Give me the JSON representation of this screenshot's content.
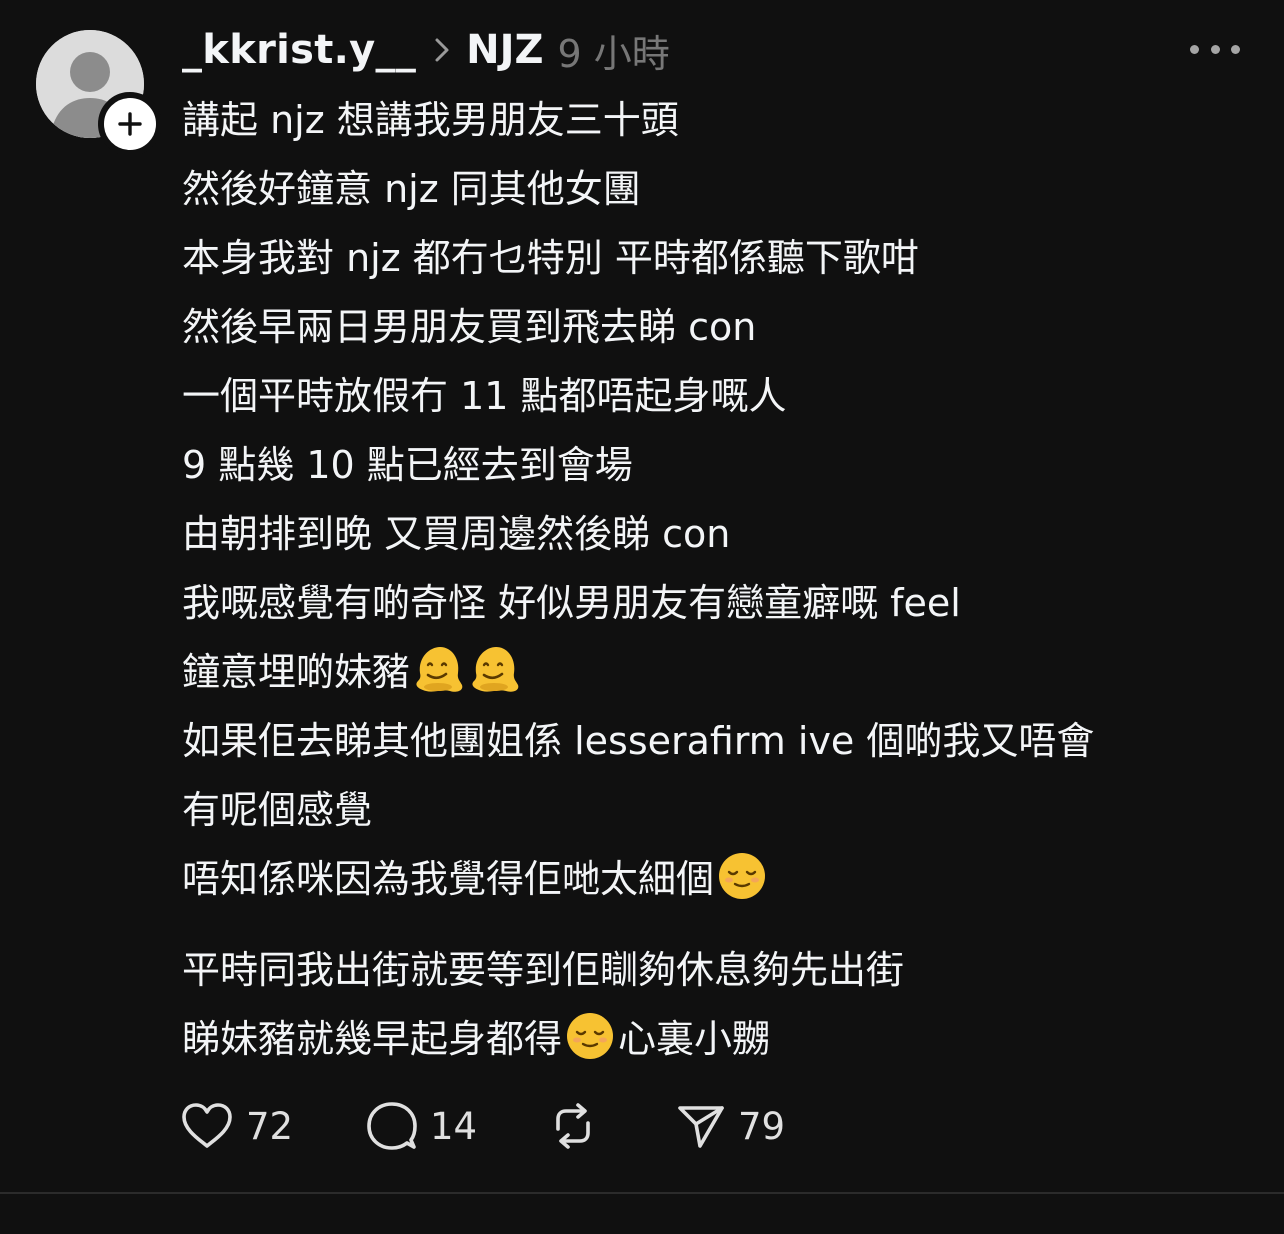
{
  "post": {
    "username": "_kkrist.y__",
    "community": "NJZ",
    "time": "9 小時",
    "body_lines": [
      "講起 njz 想講我男朋友三十頭",
      "然後好鐘意 njz 同其他女團",
      "本身我對 njz 都冇乜特別 平時都係聽下歌咁",
      "然後早兩日男朋友買到飛去睇 con",
      "一個平時放假冇 11 點都唔起身嘅人",
      "9 點幾 10 點已經去到會場",
      "由朝排到晚 又買周邊然後睇 con",
      "我嘅感覺有啲奇怪 好似男朋友有戀童癖嘅 feel"
    ],
    "line_emoji_1": "鐘意埋啲妹豬",
    "line_after_1": [
      "如果佢去睇其他團姐係 lesserafirm ive 個啲我又唔會",
      "有呢個感覺"
    ],
    "line_emoji_2": "唔知係咪因為我覺得佢哋太細個",
    "line_para2_1": "平時同我出街就要等到佢瞓夠休息夠先出街",
    "line_para2_2a": "睇妹豬就幾早起身都得",
    "line_para2_2b": "心裏小嬲",
    "icons": {
      "avatar": "default-avatar-icon",
      "follow": "plus-icon",
      "more": "more-horizontal-icon",
      "emoji_melting": "melting-face-emoji",
      "emoji_sleepy": "relieved-face-emoji"
    }
  },
  "actions": {
    "likes": "72",
    "comments": "14",
    "shares": "79"
  },
  "colors": {
    "background": "#101010",
    "text": "#f3f5f7",
    "muted": "#777777"
  }
}
